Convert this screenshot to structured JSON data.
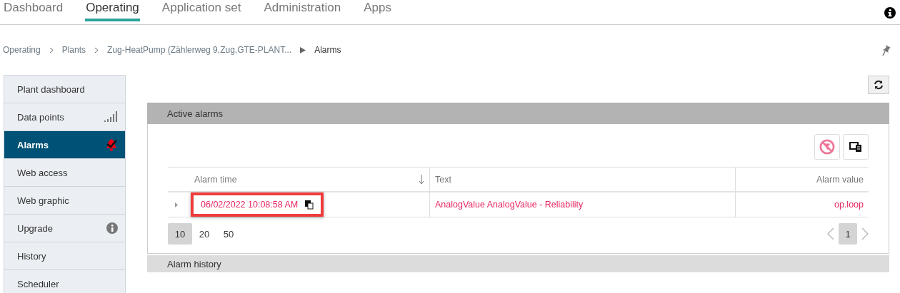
{
  "nav_tabs": [
    {
      "label": "Dashboard",
      "selected": false
    },
    {
      "label": "Operating",
      "selected": true
    },
    {
      "label": "Application set",
      "selected": false
    },
    {
      "label": "Administration",
      "selected": false
    },
    {
      "label": "Apps",
      "selected": false
    }
  ],
  "breadcrumb": [
    {
      "label": "Operating"
    },
    {
      "label": "Plants"
    },
    {
      "label": "Zug-HeatPump (Zählerweg 9,Zug,GTE-PLANT..."
    },
    {
      "label": "Alarms"
    }
  ],
  "sidebar": {
    "items": [
      {
        "label": "Plant dashboard",
        "selected": false,
        "kind": "plain"
      },
      {
        "label": "Data points",
        "selected": false,
        "kind": "signal"
      },
      {
        "label": "Alarms",
        "selected": true,
        "kind": "alarm"
      },
      {
        "label": "Web access",
        "selected": false,
        "kind": "plain"
      },
      {
        "label": "Web graphic",
        "selected": false,
        "kind": "plain"
      },
      {
        "label": "Upgrade",
        "selected": false,
        "kind": "info"
      },
      {
        "label": "History",
        "selected": false,
        "kind": "plain"
      },
      {
        "label": "Scheduler",
        "selected": false,
        "kind": "plain"
      }
    ]
  },
  "active_alarms": {
    "title": "Active alarms",
    "table": {
      "columns": [
        "Alarm time",
        "Text",
        "Alarm value"
      ],
      "rows": [
        {
          "alarm_time": "06/02/2022 10:08:58 AM",
          "text": "AnalogValue AnalogValue - Reliability",
          "alarm_value": "op.loop",
          "highlighted": true
        }
      ]
    },
    "page_sizes": [
      {
        "label": "10",
        "selected": true
      },
      {
        "label": "20",
        "selected": false
      },
      {
        "label": "50",
        "selected": false
      }
    ],
    "pages": [
      {
        "label": "1",
        "selected": true
      }
    ]
  },
  "alarm_history": {
    "title": "Alarm history"
  }
}
